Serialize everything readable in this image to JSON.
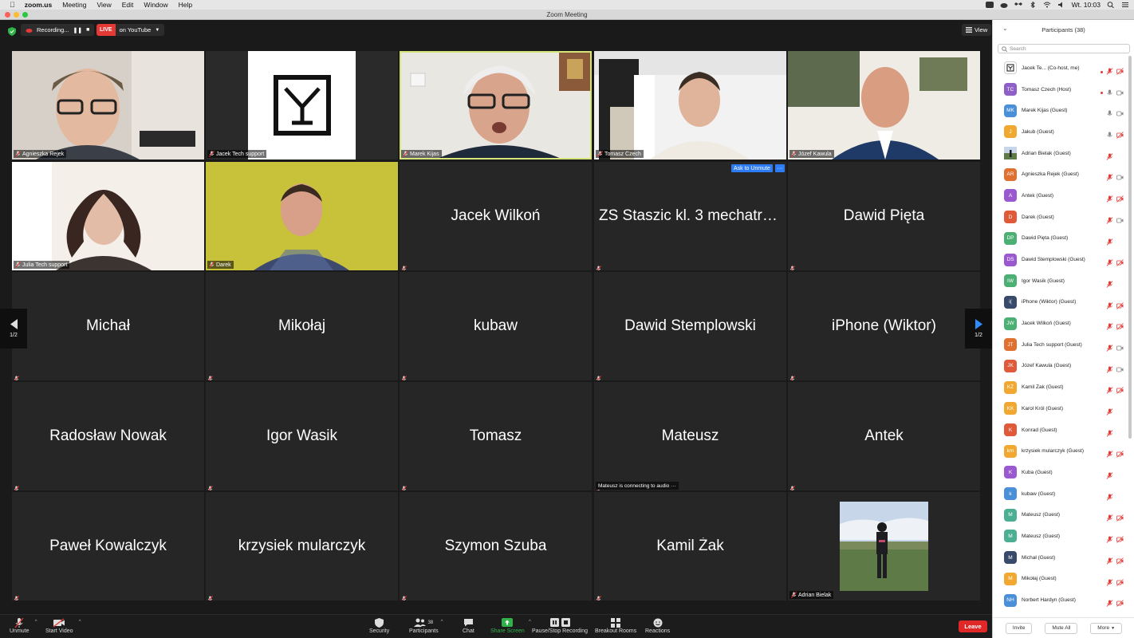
{
  "menubar": {
    "app": "zoom.us",
    "items": [
      "Meeting",
      "View",
      "Edit",
      "Window",
      "Help"
    ],
    "clock": "Wt. 10:03"
  },
  "window": {
    "title": "Zoom Meeting"
  },
  "topbar": {
    "recording": "Recording...",
    "live_badge": "LIVE",
    "live_target": "on YouTube",
    "view_label": "View"
  },
  "tiles": [
    {
      "type": "video",
      "label": "Agnieszka Rejek",
      "scene": "man"
    },
    {
      "type": "video",
      "label": "Jacek Tech support",
      "scene": "logo"
    },
    {
      "type": "video",
      "label": "Marek Kijas",
      "scene": "older",
      "speaking": true
    },
    {
      "type": "video",
      "label": "Tomasz Czech",
      "scene": "office"
    },
    {
      "type": "video",
      "label": "Józef Kawula",
      "scene": "bald"
    },
    {
      "type": "video",
      "label": "Julia Tech support",
      "scene": "woman"
    },
    {
      "type": "video",
      "label": "Darek",
      "scene": "yellow"
    },
    {
      "type": "name",
      "name": "Jacek Wilkoń"
    },
    {
      "type": "name",
      "name": "ZS Staszic kl. 3 mechatro..."
    },
    {
      "type": "name",
      "name": "Dawid Pięta"
    },
    {
      "type": "name",
      "name": "Michał"
    },
    {
      "type": "name",
      "name": "Mikołaj"
    },
    {
      "type": "name",
      "name": "kubaw"
    },
    {
      "type": "name",
      "name": "Dawid Stemplowski"
    },
    {
      "type": "name",
      "name": "iPhone (Wiktor)"
    },
    {
      "type": "name",
      "name": "Radosław Nowak"
    },
    {
      "type": "name",
      "name": "Igor Wasik"
    },
    {
      "type": "name",
      "name": "Tomasz"
    },
    {
      "type": "name",
      "name": "Mateusz"
    },
    {
      "type": "name",
      "name": "Antek"
    },
    {
      "type": "name",
      "name": "Paweł Kowalczyk"
    },
    {
      "type": "name",
      "name": "krzysiek mularczyk"
    },
    {
      "type": "name",
      "name": "Szymon Szuba"
    },
    {
      "type": "name",
      "name": "Kamil Żak"
    },
    {
      "type": "photo",
      "label": "Adrian Bielak"
    }
  ],
  "overlays": {
    "ask_to_unmute": "Ask to Unmute",
    "more": "···",
    "toast": "Mateusz is connecting to audio ···",
    "page_left": "1/2",
    "page_right": "1/2"
  },
  "toolbar": {
    "unmute": "Unmute",
    "start_video": "Start Video",
    "security": "Security",
    "participants": "Participants",
    "participants_count": "38",
    "chat": "Chat",
    "share_screen": "Share Screen",
    "pause_recording": "Pause/Stop Recording",
    "breakout": "Breakout Rooms",
    "reactions": "Reactions",
    "leave": "Leave"
  },
  "panel": {
    "title": "Participants (38)",
    "search_placeholder": "Search",
    "participants": [
      {
        "initials": "",
        "name": "Jacek Te... (Co-host, me)",
        "color": "#ffffff",
        "mic": "off",
        "cam": "off",
        "avatar": "logo",
        "rec": true
      },
      {
        "initials": "TC",
        "name": "Tomasz Czech (Host)",
        "color": "#8e5fc7",
        "mic": "on",
        "cam": "on",
        "rec": true
      },
      {
        "initials": "MK",
        "name": "Marek Kijas (Guest)",
        "color": "#4a90d9",
        "mic": "on",
        "cam": "on"
      },
      {
        "initials": "J",
        "name": "Jakub (Guest)",
        "color": "#f0a830",
        "mic": "on",
        "cam": "off"
      },
      {
        "initials": "",
        "name": "Adrian Bielak (Guest)",
        "color": "#7a8a6a",
        "mic": "off",
        "cam": "none",
        "avatar": "photo"
      },
      {
        "initials": "AR",
        "name": "Agnieszka Rejek (Guest)",
        "color": "#e07030",
        "mic": "off",
        "cam": "on"
      },
      {
        "initials": "A",
        "name": "Antek (Guest)",
        "color": "#9b59d0",
        "mic": "off",
        "cam": "off"
      },
      {
        "initials": "D",
        "name": "Darek (Guest)",
        "color": "#e05a3a",
        "mic": "off",
        "cam": "on"
      },
      {
        "initials": "DP",
        "name": "Dawid Pięta (Guest)",
        "color": "#4caf73",
        "mic": "off",
        "cam": "none"
      },
      {
        "initials": "DS",
        "name": "Dawid Stemplowski (Guest)",
        "color": "#9b59d0",
        "mic": "off",
        "cam": "off"
      },
      {
        "initials": "IW",
        "name": "Igor Wasik (Guest)",
        "color": "#4caf73",
        "mic": "off",
        "cam": "none"
      },
      {
        "initials": "i(",
        "name": "iPhone (Wiktor) (Guest)",
        "color": "#3a4a6a",
        "mic": "off",
        "cam": "off"
      },
      {
        "initials": "JW",
        "name": "Jacek Wilkoń (Guest)",
        "color": "#4caf73",
        "mic": "off",
        "cam": "off"
      },
      {
        "initials": "JT",
        "name": "Julia Tech support (Guest)",
        "color": "#e07030",
        "mic": "off",
        "cam": "on"
      },
      {
        "initials": "JK",
        "name": "Józef Kawula (Guest)",
        "color": "#e05a3a",
        "mic": "off",
        "cam": "on"
      },
      {
        "initials": "KŻ",
        "name": "Kamil Żak (Guest)",
        "color": "#f0a830",
        "mic": "off",
        "cam": "off"
      },
      {
        "initials": "KK",
        "name": "Karol Król (Guest)",
        "color": "#f0a830",
        "mic": "off",
        "cam": "none"
      },
      {
        "initials": "K",
        "name": "Konrad (Guest)",
        "color": "#e05a3a",
        "mic": "off",
        "cam": "none"
      },
      {
        "initials": "km",
        "name": "krzysiek mularczyk (Guest)",
        "color": "#f0a830",
        "mic": "off",
        "cam": "off"
      },
      {
        "initials": "K",
        "name": "Kuba (Guest)",
        "color": "#9b59d0",
        "mic": "off",
        "cam": "none"
      },
      {
        "initials": "k",
        "name": "kubaw (Guest)",
        "color": "#4a90d9",
        "mic": "off",
        "cam": "none"
      },
      {
        "initials": "M",
        "name": "Mateusz (Guest)",
        "color": "#4caf93",
        "mic": "off",
        "cam": "off"
      },
      {
        "initials": "M",
        "name": "Mateusz (Guest)",
        "color": "#4caf93",
        "mic": "off",
        "cam": "off"
      },
      {
        "initials": "M",
        "name": "Michał (Guest)",
        "color": "#3a4a6a",
        "mic": "off",
        "cam": "off"
      },
      {
        "initials": "M",
        "name": "Mikołaj (Guest)",
        "color": "#f0a830",
        "mic": "off",
        "cam": "off"
      },
      {
        "initials": "NH",
        "name": "Norbert Hardyn (Guest)",
        "color": "#4a90d9",
        "mic": "off",
        "cam": "off"
      }
    ],
    "invite": "Invite",
    "mute_all": "Mute All",
    "more": "More"
  }
}
